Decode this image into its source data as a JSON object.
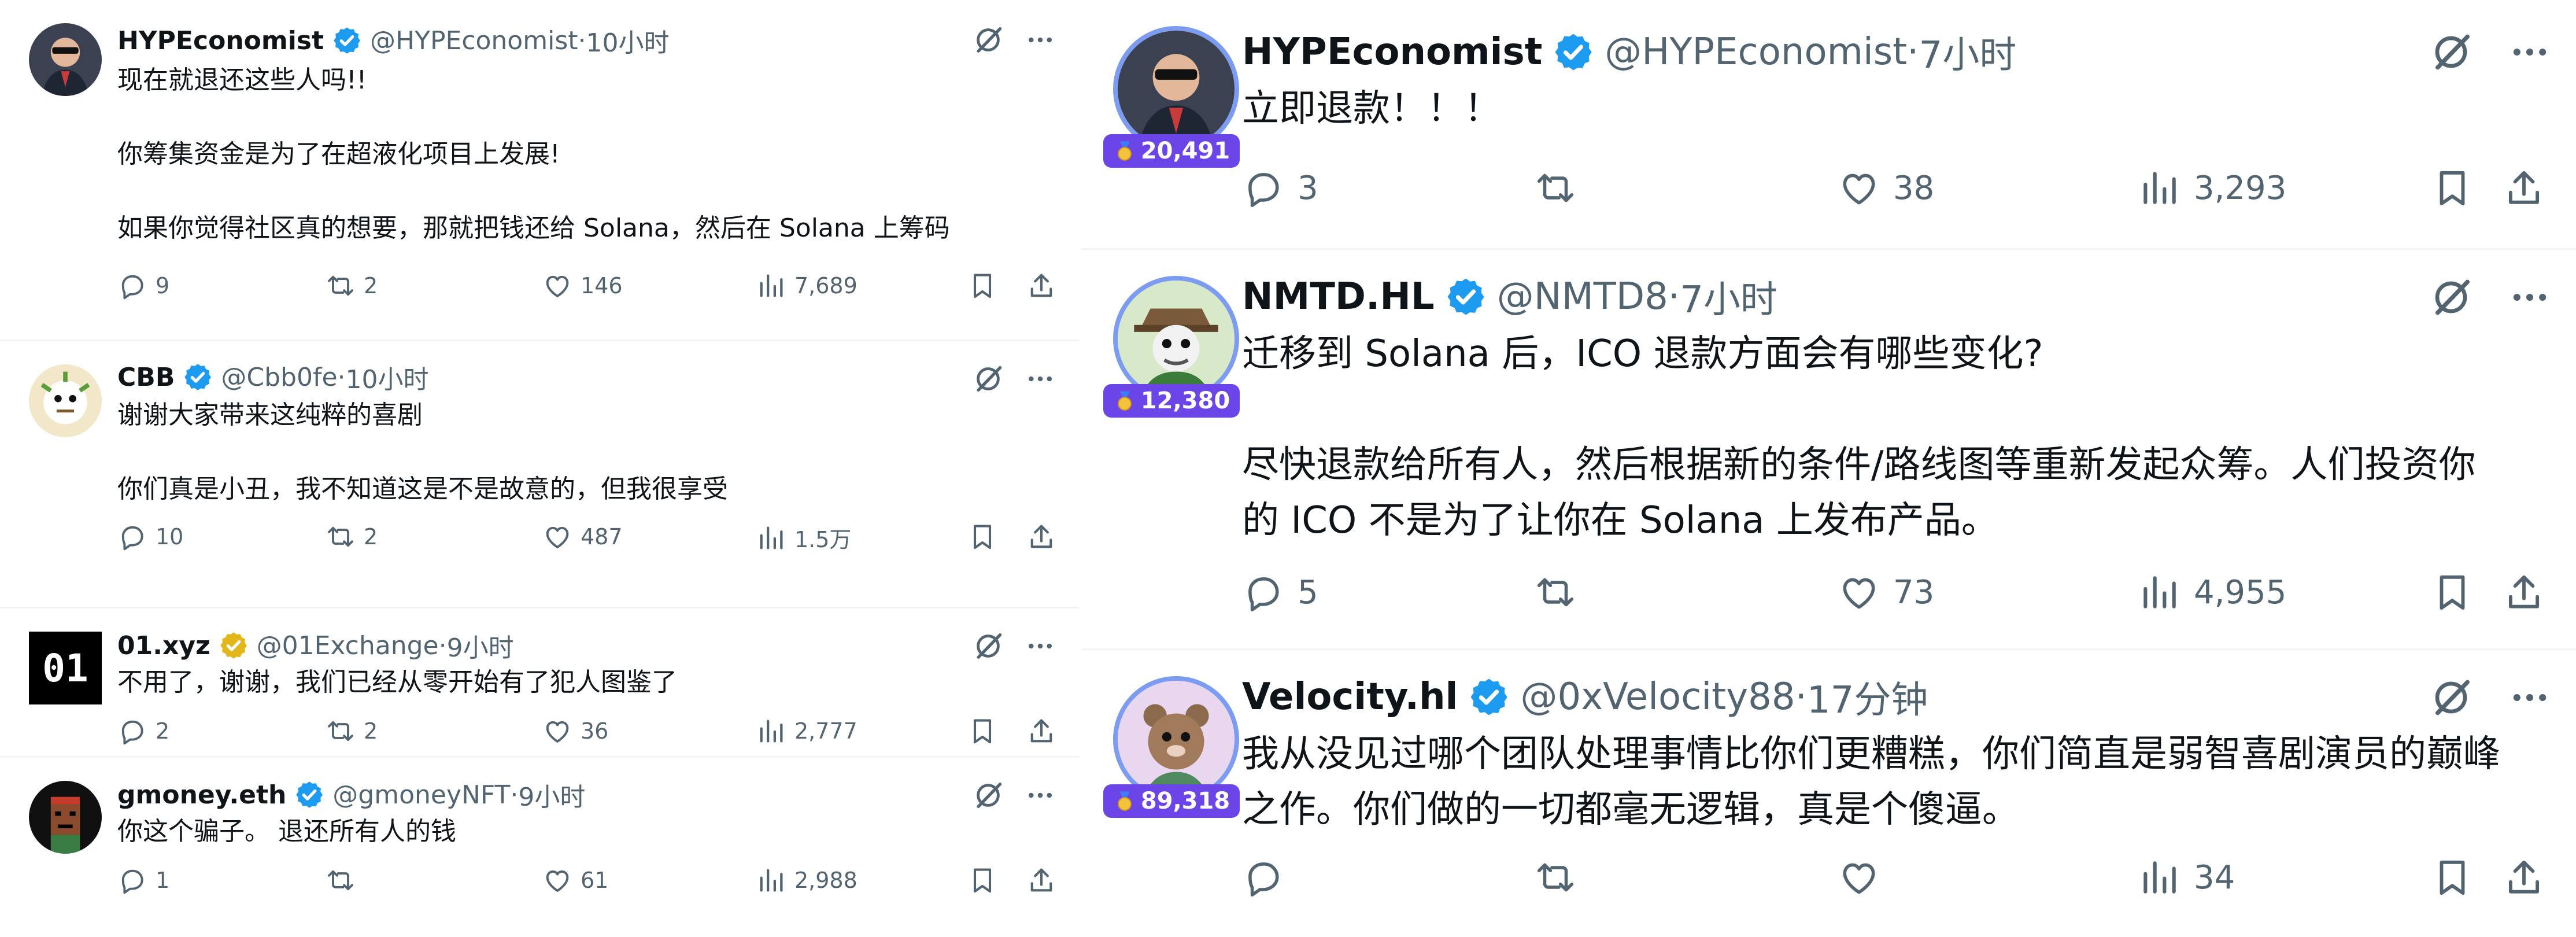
{
  "left": {
    "tweets": [
      {
        "name": "HYPEconomist",
        "handle": "@HYPEconomist",
        "sep": " · ",
        "time": "10小时",
        "text": "现在就退还这些人吗!!\n\n你筹集资金是为了在超液化项目上发展!\n\n如果你觉得社区真的想要，那就把钱还给 Solana，然后在 Solana 上筹码",
        "replies": "9",
        "retweets": "2",
        "likes": "146",
        "views": "7,689"
      },
      {
        "name": "CBB",
        "handle": "@Cbb0fe",
        "sep": " · ",
        "time": "10小时",
        "text": "谢谢大家带来这纯粹的喜剧\n\n你们真是小丑，我不知道这是不是故意的，但我很享受",
        "replies": "10",
        "retweets": "2",
        "likes": "487",
        "views": "1.5万"
      },
      {
        "name": "01.xyz",
        "handle": "@01Exchange",
        "sep": " · ",
        "time": "9小时",
        "avatar_text": "01",
        "text": "不用了，谢谢，我们已经从零开始有了犯人图鉴了",
        "replies": "2",
        "retweets": "2",
        "likes": "36",
        "views": "2,777"
      },
      {
        "name": "gmoney.eth",
        "handle": "@gmoneyNFT",
        "sep": " · ",
        "time": "9小时",
        "text": "你这个骗子。 退还所有人的钱",
        "replies": "1",
        "retweets": "",
        "likes": "61",
        "views": "2,988"
      }
    ]
  },
  "right": {
    "tweets": [
      {
        "name": "HYPEconomist",
        "handle": "@HYPEconomist",
        "sep": " · ",
        "time": "7小时",
        "badge": "20,491",
        "text": "立即退款！！！",
        "replies": "3",
        "retweets": "",
        "likes": "38",
        "views": "3,293"
      },
      {
        "name": "NMTD.HL",
        "handle": "@NMTD8",
        "sep": " · ",
        "time": "7小时",
        "badge": "12,380",
        "text": "迁移到 Solana 后，ICO 退款方面会有哪些变化?\n\n尽快退款给所有人，然后根据新的条件/路线图等重新发起众筹。人们投资你\n的 ICO 不是为了让你在 Solana 上发布产品。",
        "replies": "5",
        "retweets": "",
        "likes": "73",
        "views": "4,955"
      },
      {
        "name": "Velocity.hl",
        "handle": "@0xVelocity88",
        "sep": " · ",
        "time": "17分钟",
        "badge": "89,318",
        "text": "我从没见过哪个团队处理事情比你们更糟糕，你们简直是弱智喜剧演员的巅峰\n之作。你们做的一切都毫无逻辑，真是个傻逼。",
        "replies": "",
        "retweets": "",
        "likes": "",
        "views": "34"
      }
    ]
  },
  "colors": {
    "verified_blue": "#1d9bf0",
    "verified_gold": "#e2b719",
    "badge_purple": "#6b45e8",
    "muted": "#536471"
  },
  "icons": {
    "top": [
      "grok-icon",
      "more-icon"
    ],
    "actions": [
      "reply-icon",
      "retweet-icon",
      "like-icon",
      "views-icon",
      "bookmark-icon",
      "share-icon"
    ]
  }
}
